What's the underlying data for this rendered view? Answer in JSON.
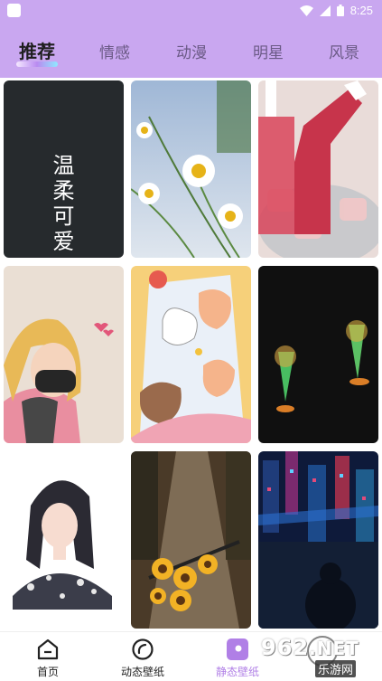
{
  "status_bar": {
    "time": "8:25"
  },
  "tabs": [
    {
      "label": "推荐",
      "active": true
    },
    {
      "label": "情感",
      "active": false
    },
    {
      "label": "动漫",
      "active": false
    },
    {
      "label": "明星",
      "active": false
    },
    {
      "label": "风景",
      "active": false
    }
  ],
  "wallpapers": {
    "text_card_lines": [
      "温",
      "柔",
      "可",
      "爱"
    ]
  },
  "bottom_nav": [
    {
      "label": "首页",
      "icon": "home-icon"
    },
    {
      "label": "动态壁纸",
      "icon": "live-wallpaper-icon"
    },
    {
      "label": "静态壁纸",
      "icon": "static-wallpaper-icon",
      "active": true,
      "accent": "#b07fe6"
    }
  ],
  "watermark": {
    "brand_number": "962",
    "brand_suffix": ".NET",
    "brand_cn": "乐游网"
  },
  "colors": {
    "header": "#c9a7f0",
    "accent": "#b07fe6"
  }
}
